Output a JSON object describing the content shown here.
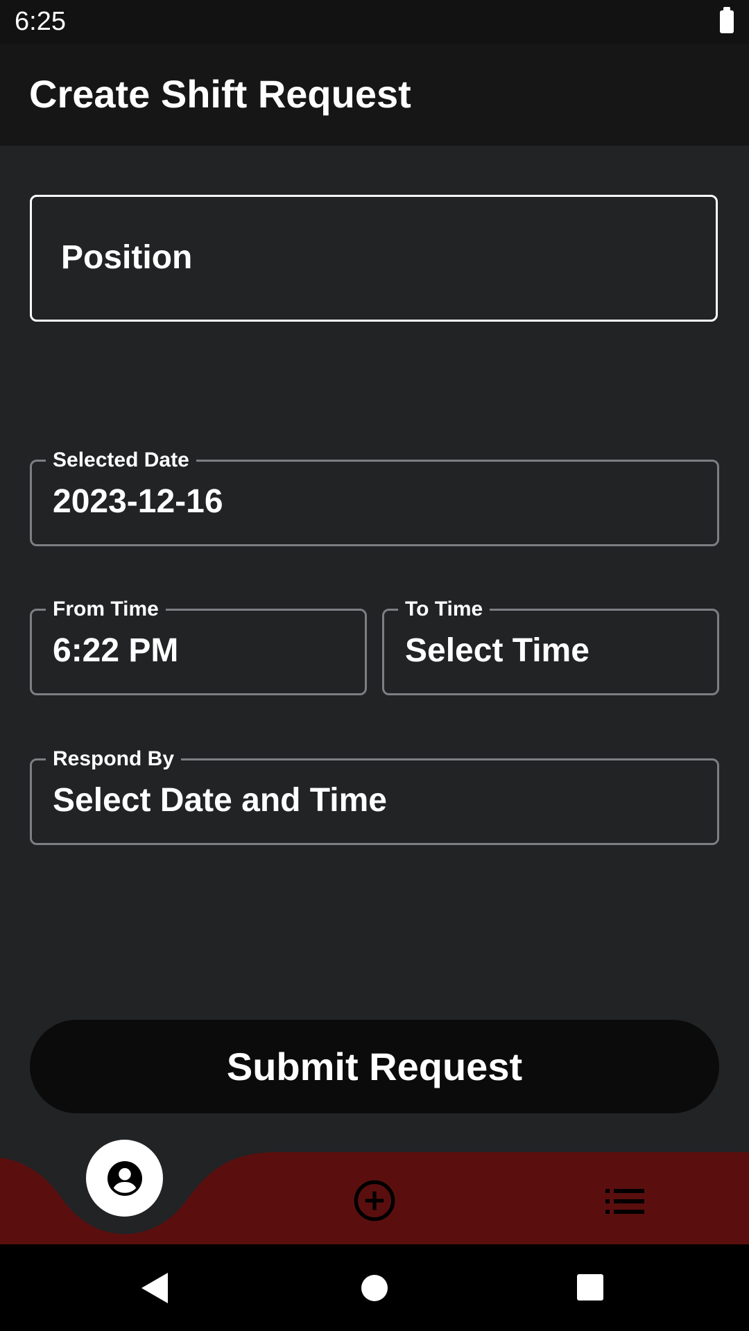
{
  "status_bar": {
    "time": "6:25",
    "battery_icon": "battery-full-icon"
  },
  "app_bar": {
    "title": "Create Shift Request"
  },
  "form": {
    "position_placeholder": "Position",
    "selected_date": {
      "label": "Selected Date",
      "value": "2023-12-16"
    },
    "from_time": {
      "label": "From Time",
      "value": "6:22 PM"
    },
    "to_time": {
      "label": "To Time",
      "value": "Select Time"
    },
    "respond_by": {
      "label": "Respond By",
      "value": "Select Date and Time"
    }
  },
  "submit_label": "Submit Request",
  "bottom_nav": {
    "background_color": "#5a0f0e",
    "items": [
      {
        "icon": "account-circle-icon",
        "selected": true
      },
      {
        "icon": "add-circle-icon",
        "selected": false
      },
      {
        "icon": "list-icon",
        "selected": false
      }
    ]
  },
  "system_nav": {
    "icons": [
      "back-icon",
      "home-icon",
      "recents-icon"
    ]
  },
  "colors": {
    "background": "#212325",
    "app_bar": "#161616",
    "button": "#0b0b0b",
    "outline": "#7d7f82"
  }
}
